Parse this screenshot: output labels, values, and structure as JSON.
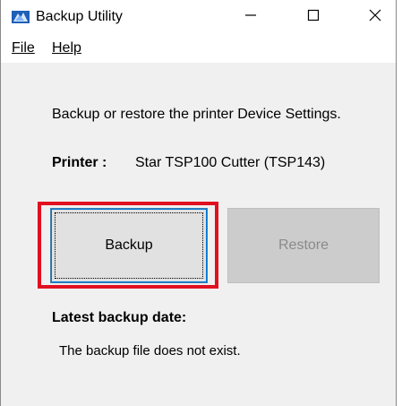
{
  "window": {
    "title": "Backup Utility",
    "icons": {
      "app": "backup-utility-icon",
      "minimize": "minimize-icon",
      "maximize": "maximize-icon",
      "close": "close-icon"
    }
  },
  "menu": {
    "file": "File",
    "help": "Help"
  },
  "description": "Backup or restore the printer Device Settings.",
  "printer": {
    "label": "Printer :",
    "value": "Star TSP100 Cutter (TSP143)"
  },
  "buttons": {
    "backup": "Backup",
    "restore": "Restore"
  },
  "latest_backup": {
    "label": "Latest backup date:",
    "value": "The backup file does not exist."
  },
  "colors": {
    "highlight": "#e01020",
    "disabled_text": "#8a8a8a",
    "focus_border": "#0078d7"
  }
}
